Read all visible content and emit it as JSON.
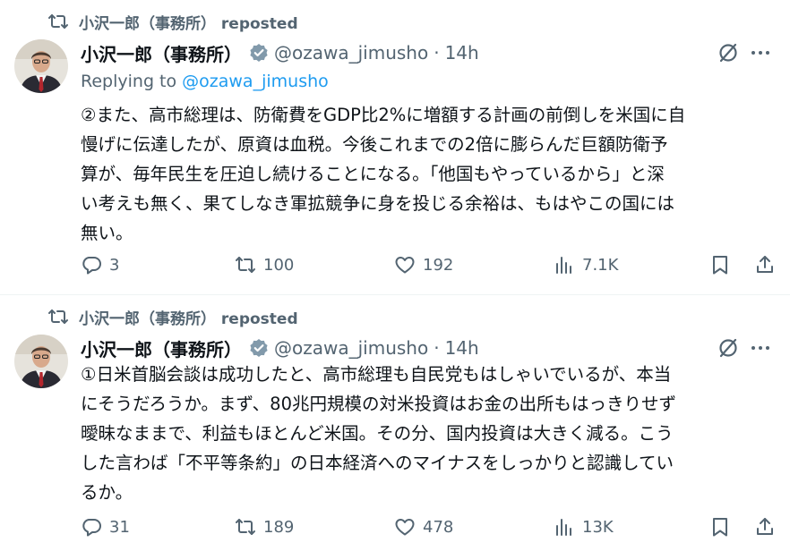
{
  "tweets": [
    {
      "repost_label": "小沢一郎（事務所） reposted",
      "author_name": "小沢一郎（事務所）",
      "handle": "@ozawa_jimusho",
      "separator": "·",
      "time": "14h",
      "replying_prefix": "Replying to ",
      "replying_to": "@ozawa_jimusho",
      "text_lines": [
        "②また、高市総理は、防衛費をGDP比2%に増額する計画の前倒しを米国に自",
        "慢げに伝達したが、原資は血税。今後これまでの2倍に膨らんだ巨額防衛予",
        "算が、毎年民生を圧迫し続けることになる。「他国もやっているから」と深",
        "い考えも無く、果てしなき軍拡競争に身を投じる余裕は、もはやこの国には",
        "無い。"
      ],
      "replies": "3",
      "reposts": "100",
      "likes": "192",
      "views": "7.1K"
    },
    {
      "repost_label": "小沢一郎（事務所） reposted",
      "author_name": "小沢一郎（事務所）",
      "handle": "@ozawa_jimusho",
      "separator": "·",
      "time": "14h",
      "text_lines": [
        "①日米首脳会談は成功したと、高市総理も自民党もはしゃいでいるが、本当",
        "にそうだろうか。まず、80兆円規模の対米投資はお金の出所もはっきりせず",
        "曖昧なままで、利益もほとんど米国。その分、国内投資は大きく減る。こう",
        "した言わば「不平等条約」の日本経済へのマイナスをしっかりと認識してい",
        "るか。"
      ],
      "replies": "31",
      "reposts": "189",
      "likes": "478",
      "views": "13K"
    }
  ],
  "colors": {
    "text": "#0f1419",
    "secondary": "#536471",
    "link": "#1d9bf0",
    "verified": "#829aab",
    "divider": "#eff3f4"
  },
  "icons": [
    "repost-icon",
    "verified-badge-icon",
    "grok-icon",
    "more-icon",
    "reply-icon",
    "like-icon",
    "views-icon",
    "bookmark-icon",
    "share-icon"
  ]
}
